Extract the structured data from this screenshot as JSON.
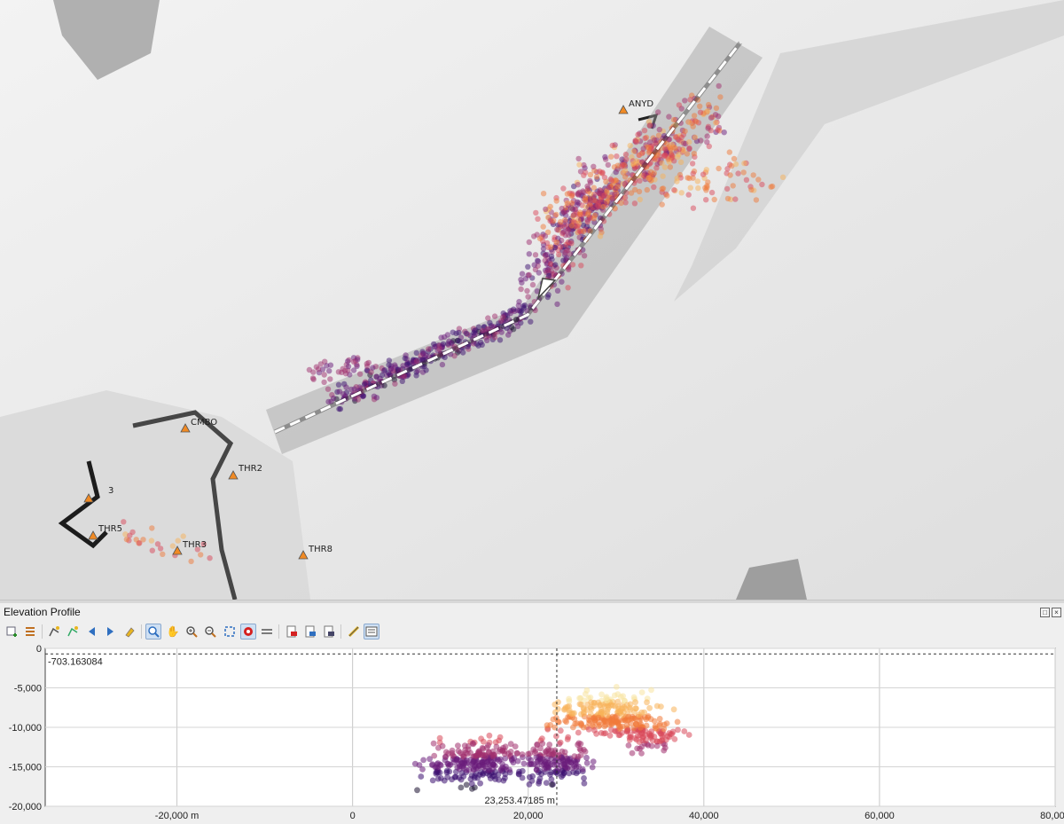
{
  "map": {
    "stations": [
      {
        "label": "ANYD"
      },
      {
        "label": "CMBO"
      },
      {
        "label": "THR2"
      },
      {
        "label": "3"
      },
      {
        "label": "THR5"
      },
      {
        "label": "THR3"
      },
      {
        "label": "THR8"
      }
    ],
    "colors": {
      "station_marker": "#f08a24",
      "profile_line": "#ffffff",
      "buffer": "#9e9e9e"
    }
  },
  "panel": {
    "title": "Elevation Profile",
    "toolbar_icons": [
      "add-layers-icon",
      "options-icon",
      "capture-curve-icon",
      "capture-curve-from-feature-icon",
      "previous-icon",
      "next-icon",
      "clear-icon",
      "zoom-pan-icon",
      "pan-icon",
      "zoom-in-icon",
      "zoom-out-icon",
      "zoom-full-icon",
      "snapping-icon",
      "lock-distance-icon",
      "export-pdf-icon",
      "export-image-icon",
      "export-dxf-icon",
      "measure-icon",
      "settings-icon"
    ],
    "window_buttons": [
      "float-icon",
      "close-icon"
    ]
  },
  "chart_data": {
    "type": "scatter",
    "xlim": [
      -35000,
      80000
    ],
    "ylim": [
      -20000,
      0
    ],
    "x_ticks": [
      "-20,000 m",
      "0",
      "20,000",
      "40,000",
      "60,000",
      "80,000"
    ],
    "y_ticks": [
      "0",
      "-5,000",
      "-10,000",
      "-15,000",
      "-20,000"
    ],
    "crosshair": {
      "x_label": "23,253.47185 m",
      "y_label": "-703.163084",
      "x": 23253.47185,
      "y": -703.163084
    },
    "grid": true,
    "colormap": [
      "#1a1030",
      "#3b0f6f",
      "#6a1b7a",
      "#a0306e",
      "#d9485a",
      "#f07a3a",
      "#f8b25a",
      "#f7e3a0"
    ]
  }
}
